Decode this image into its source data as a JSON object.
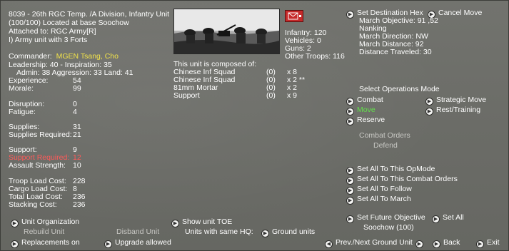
{
  "unit": {
    "header_line1": "8039 - 26th RGC Temp. /A Division, Infantry Unit",
    "header_line2": "(100/100) Located at base Soochow",
    "attached": "Attached to: RGC Army[R]",
    "army_unit": "I) Army unit with 3 Forts",
    "commander_label": "Commander:",
    "commander_name": "MGEN Tsang, Cho",
    "leadership": "Leadership: 40 - Inspiration: 35",
    "admin": "Admin: 38  Aggression: 33 Land: 41"
  },
  "stats": [
    {
      "label": "Experience:",
      "value": "54"
    },
    {
      "label": "Morale:",
      "value": "99"
    },
    {
      "label": "Disruption:",
      "value": "0"
    },
    {
      "label": "Fatigue:",
      "value": "4"
    },
    {
      "label": "Supplies:",
      "value": "31"
    },
    {
      "label": "Supplies Required:",
      "value": "21"
    },
    {
      "label": "Support:",
      "value": "9"
    },
    {
      "label": "Support Required:",
      "value": "12"
    },
    {
      "label": "Assault Strength:",
      "value": "10"
    },
    {
      "label": "Troop Load Cost:",
      "value": "228"
    },
    {
      "label": "Cargo Load Cost:",
      "value": "8"
    },
    {
      "label": "Total Load Cost:",
      "value": "236"
    },
    {
      "label": "Stacking Cost:",
      "value": "236"
    }
  ],
  "composition": {
    "infantry": "Infantry: 120",
    "vehicles": "Vehicles: 0",
    "guns": "Guns: 2",
    "other": "Other Troops: 116",
    "composed_title": "This unit is composed of:",
    "rows": [
      {
        "name": "Chinese Inf Squad",
        "dmg": "(0)",
        "count": "x 8"
      },
      {
        "name": "Chinese Inf Squad",
        "dmg": "(0)",
        "count": "x 2 **"
      },
      {
        "name": "81mm Mortar",
        "dmg": "(0)",
        "count": "x 2"
      },
      {
        "name": "Support",
        "dmg": "(0)",
        "count": "x 9"
      }
    ]
  },
  "march": {
    "set_destination": "Set Destination Hex",
    "cancel_move": "Cancel Move",
    "objective": "March Objective: 91 ,52",
    "place": "Nanking",
    "direction": "March Direction: NW",
    "distance": "March Distance: 92",
    "traveled": "Distance Traveled: 30"
  },
  "ops": {
    "title": "Select Operations Mode",
    "combat": "Combat",
    "strategic": "Strategic Move",
    "move": "Move",
    "rest": "Rest/Training",
    "reserve": "Reserve",
    "combat_orders": "Combat Orders",
    "defend": "Defend"
  },
  "setall": {
    "opmode": "Set All To This OpMode",
    "combat_orders": "Set All To This Combat Orders",
    "follow": "Set All To Follow",
    "march": "Set All To March",
    "future_objective": "Set Future Objective",
    "set_all": "Set All",
    "soochow": "Soochow (100)"
  },
  "bottom": {
    "unit_org": "Unit Organization",
    "show_toe": "Show unit TOE",
    "rebuild": "Rebuild Unit",
    "disband": "Disband Unit",
    "same_hq": "Units with same HQ:",
    "ground_units": "Ground units",
    "replacements": "Replacements on",
    "upgrade": "Upgrade allowed",
    "prev_next": "Prev./Next Ground Unit",
    "back": "Back",
    "exit": "Exit"
  },
  "colors": {
    "background": "#6b6c67",
    "commander": "#f2e34a",
    "move_active": "#63e04c",
    "support_required": "#ff5a5a"
  }
}
